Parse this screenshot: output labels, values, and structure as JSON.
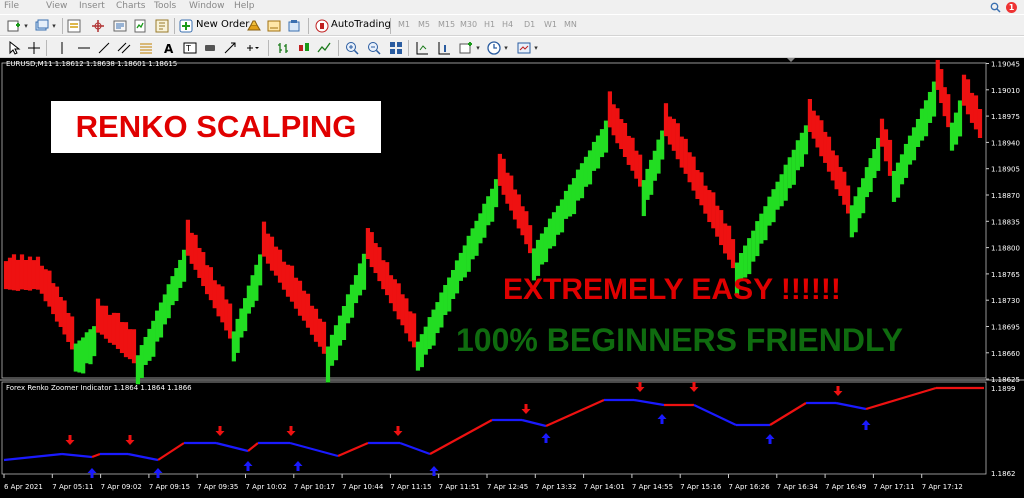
{
  "menu": {
    "items": [
      "File",
      "View",
      "Insert",
      "Charts",
      "Tools",
      "Window",
      "Help"
    ],
    "notification_count": "1"
  },
  "toolbar": {
    "new_order_label": "New Order",
    "autotrading_label": "AutoTrading",
    "timeframes": [
      "M1",
      "M5",
      "M15",
      "M30",
      "H1",
      "H4",
      "D1",
      "W1",
      "MN"
    ]
  },
  "chart": {
    "title": "EURUSD,M11  1.18612 1.18638 1.18601 1.18615",
    "price_labels": [
      "1.19045",
      "1.19010",
      "1.18975",
      "1.18940",
      "1.18905",
      "1.18870",
      "1.18835",
      "1.18800",
      "1.18765",
      "1.18730",
      "1.18695",
      "1.18660",
      "1.18625"
    ],
    "indicator_title": "Forex Renko Zoomer Indicator 1.1864 1.1864 1.1866",
    "indicator_labels": [
      "1.1899",
      "1.1862"
    ],
    "time_labels": [
      "6 Apr 2021",
      "7 Apr 05:11",
      "7 Apr 09:02",
      "7 Apr 09:15",
      "7 Apr 09:35",
      "7 Apr 10:02",
      "7 Apr 10:17",
      "7 Apr 10:44",
      "7 Apr 11:15",
      "7 Apr 11:51",
      "7 Apr 12:45",
      "7 Apr 13:32",
      "7 Apr 14:01",
      "7 Apr 14:55",
      "7 Apr 15:16",
      "7 Apr 16:26",
      "7 Apr 16:34",
      "7 Apr 16:49",
      "7 Apr 17:11",
      "7 Apr 17:12"
    ],
    "colors": {
      "bull": "#22dd22",
      "bear": "#ee1111",
      "background": "#000000",
      "line_up": "#ee1111",
      "line_down": "#1a1aff"
    }
  },
  "overlay": {
    "banner": "RENKO SCALPING",
    "line1": "EXTREMELY EASY !!!!!!",
    "line2": "100% BEGINNERS FRIENDLY"
  }
}
